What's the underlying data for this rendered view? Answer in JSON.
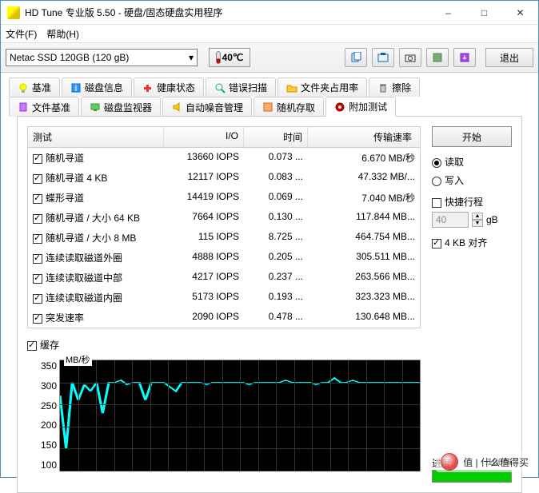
{
  "window": {
    "title": "HD Tune 专业版 5.50 - 硬盘/固态硬盘实用程序"
  },
  "menu": {
    "file": "文件(F)",
    "help": "帮助(H)"
  },
  "toolbar": {
    "drive": "Netac SSD 120GB (120 gB)",
    "temp": "40℃",
    "exit": "退出"
  },
  "tabs_row1": [
    {
      "label": "基准",
      "icon": "lightbulb"
    },
    {
      "label": "磁盘信息",
      "icon": "info"
    },
    {
      "label": "健康状态",
      "icon": "health"
    },
    {
      "label": "错误扫描",
      "icon": "search"
    },
    {
      "label": "文件夹占用率",
      "icon": "folder"
    },
    {
      "label": "擦除",
      "icon": "trash"
    }
  ],
  "tabs_row2": [
    {
      "label": "文件基准",
      "icon": "filebench"
    },
    {
      "label": "磁盘监视器",
      "icon": "monitor"
    },
    {
      "label": "自动噪音管理",
      "icon": "sound"
    },
    {
      "label": "随机存取",
      "icon": "random"
    },
    {
      "label": "附加测试",
      "icon": "extra",
      "active": true
    }
  ],
  "table": {
    "headers": {
      "test": "测试",
      "io": "I/O",
      "time": "时间",
      "rate": "传输速率"
    },
    "rows": [
      {
        "name": "随机寻道",
        "io": "13660 IOPS",
        "time": "0.073 ...",
        "rate": "6.670 MB/秒"
      },
      {
        "name": "随机寻道 4 KB",
        "io": "12117 IOPS",
        "time": "0.083 ...",
        "rate": "47.332 MB/..."
      },
      {
        "name": "蝶形寻道",
        "io": "14419 IOPS",
        "time": "0.069 ...",
        "rate": "7.040 MB/秒"
      },
      {
        "name": "随机寻道 / 大小 64 KB",
        "io": "7664 IOPS",
        "time": "0.130 ...",
        "rate": "117.844 MB..."
      },
      {
        "name": "随机寻道 / 大小 8 MB",
        "io": "115 IOPS",
        "time": "8.725 ...",
        "rate": "464.754 MB..."
      },
      {
        "name": "连续读取磁道外圈",
        "io": "4888 IOPS",
        "time": "0.205 ...",
        "rate": "305.511 MB..."
      },
      {
        "name": "连续读取磁道中部",
        "io": "4217 IOPS",
        "time": "0.237 ...",
        "rate": "263.566 MB..."
      },
      {
        "name": "连续读取磁道内圈",
        "io": "5173 IOPS",
        "time": "0.193 ...",
        "rate": "323.323 MB..."
      },
      {
        "name": "突发速率",
        "io": "2090 IOPS",
        "time": "0.478 ...",
        "rate": "130.648 MB..."
      }
    ]
  },
  "cache_label": "缓存",
  "chart_data": {
    "type": "line",
    "ylabel": "MB/秒",
    "ylim": [
      100,
      350
    ],
    "yticks": [
      100,
      150,
      200,
      250,
      300,
      350
    ],
    "values": [
      270,
      150,
      300,
      260,
      295,
      280,
      300,
      230,
      300,
      300,
      305,
      295,
      300,
      300,
      260,
      300,
      300,
      300,
      290,
      280,
      300,
      300,
      300,
      300,
      295,
      300,
      300,
      300,
      300,
      300,
      300,
      295,
      300,
      300,
      300,
      300,
      300,
      305,
      300,
      300,
      300,
      300,
      295,
      300,
      300,
      310,
      300,
      300,
      305,
      300,
      300,
      300,
      300,
      300,
      300,
      300,
      300,
      300,
      300,
      300
    ]
  },
  "side": {
    "start": "开始",
    "read": "读取",
    "write": "写入",
    "quick": "快捷行程",
    "quick_val": "40",
    "quick_unit": "gB",
    "align": "4 KB 对齐",
    "progress_label": "进度:",
    "progress_pct": "100%"
  },
  "watermark": "值 | 什么值得买"
}
